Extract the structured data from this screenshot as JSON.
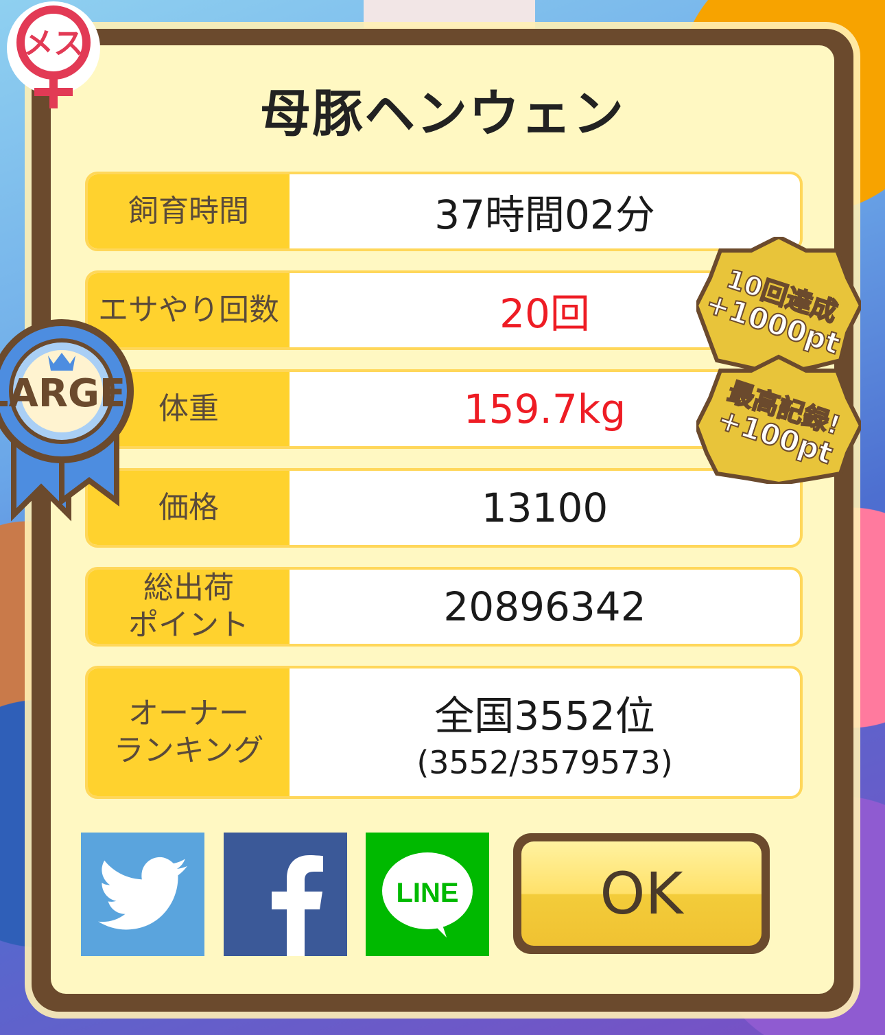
{
  "title": "母豚ヘンウェン",
  "badges": {
    "gender": "メス",
    "size": "LARGE",
    "achievement1_line1": "10回達成",
    "achievement1_line2": "+1000pt",
    "achievement2_line1": "最高記録!",
    "achievement2_line2": "+100pt"
  },
  "stats": [
    {
      "label": "飼育時間",
      "value": "37時間02分"
    },
    {
      "label": "エサやり回数",
      "value": "20回"
    },
    {
      "label": "体重",
      "value": "159.7kg"
    },
    {
      "label": "価格",
      "value": "13100"
    },
    {
      "label_line1": "総出荷",
      "label_line2": "ポイント",
      "value": "20896342"
    },
    {
      "label_line1": "オーナー",
      "label_line2": "ランキング",
      "value": "全国3552位",
      "sub": "(3552/3579573)"
    }
  ],
  "share": {
    "line_label": "LINE"
  },
  "ok_label": "OK",
  "colors": {
    "highlight_value": "#ee1c24",
    "label_bg": "#ffd22e",
    "panel_bg": "#fff8c2",
    "frame": "#6b4a2d",
    "twitter": "#5aa4dd",
    "facebook": "#3b5998",
    "line": "#00b900"
  },
  "icons": [
    "female-symbol-icon",
    "large-ribbon-icon",
    "twitter-bird-icon",
    "facebook-f-icon",
    "line-bubble-icon",
    "achievement-medal-icon"
  ]
}
